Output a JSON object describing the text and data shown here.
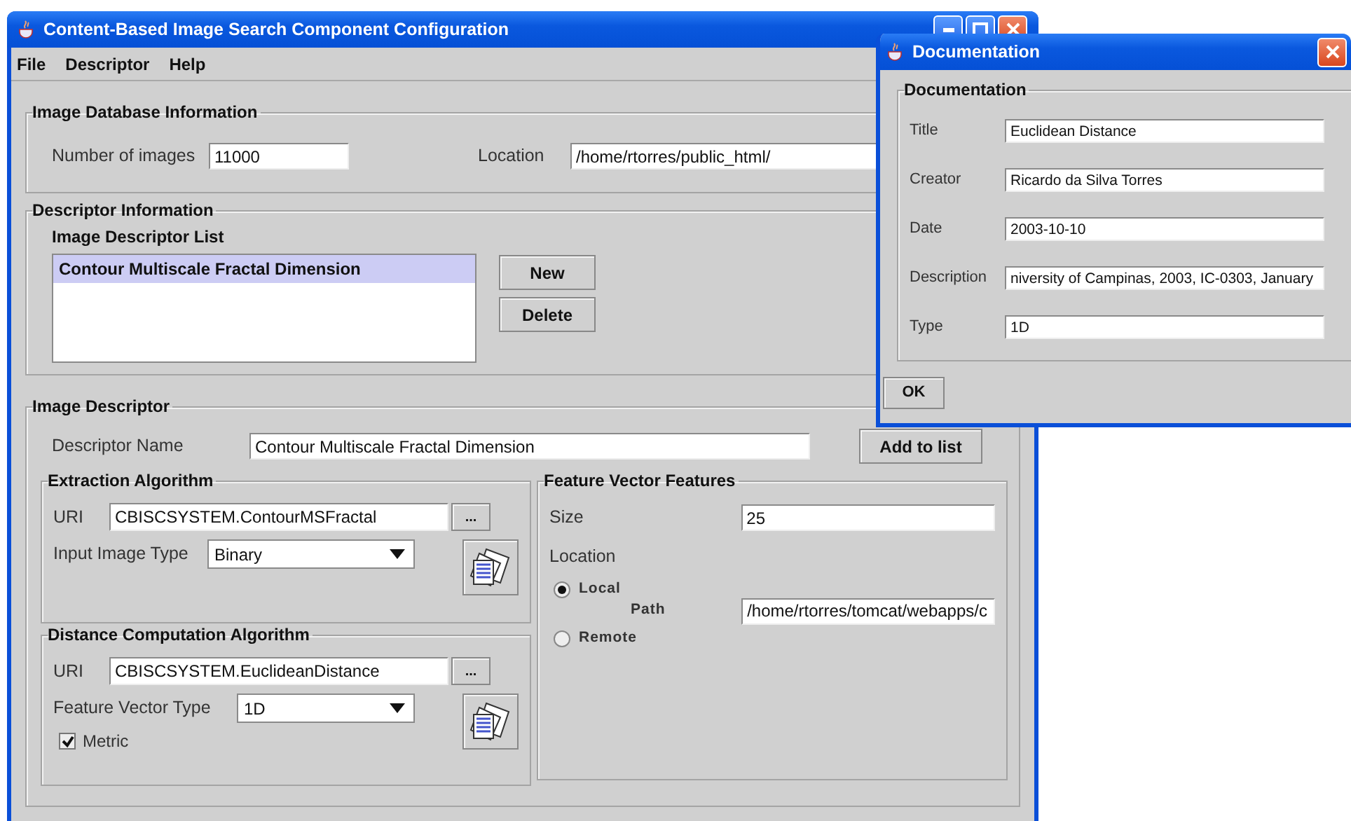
{
  "main_window": {
    "title": "Content-Based Image Search Component Configuration",
    "menu": [
      "File",
      "Descriptor",
      "Help"
    ],
    "database": {
      "title": "Image Database Information",
      "count_label": "Number of images",
      "count": "11000",
      "location_label": "Location",
      "location": "/home/rtorres/public_html/"
    },
    "descriptor_info": {
      "title": "Descriptor Information",
      "list_label": "Image Descriptor List",
      "items": [
        {
          "label": "Contour Multiscale Fractal Dimension",
          "selected": true
        }
      ],
      "buttons": [
        "New",
        "Delete"
      ]
    },
    "image_descriptor": {
      "title": "Image Descriptor",
      "name_label": "Descriptor Name",
      "name": "Contour Multiscale Fractal Dimension",
      "add_button": "Add to list",
      "extraction": {
        "title": "Extraction Algorithm",
        "uri_label": "URI",
        "uri": "CBISCSYSTEM.ContourMSFractal",
        "browse_button": "...",
        "type_label": "Input Image Type",
        "type": "Binary"
      },
      "distance": {
        "title": "Distance Computation Algorithm",
        "uri_label": "URI",
        "uri": "CBISCSYSTEM.EuclideanDistance",
        "browse_button": "...",
        "type_label": "Feature Vector Type",
        "type": "1D",
        "metric": {
          "label": "Metric",
          "checked": true
        }
      },
      "features": {
        "title": "Feature Vector Features",
        "size_label": "Size",
        "size": "25",
        "location_label": "Location",
        "options": [
          {
            "label": "Local",
            "selected": true
          },
          {
            "label": "Remote",
            "selected": false
          }
        ],
        "path_label": "Path",
        "path": "/home/rtorres/tomcat/webapps/c"
      }
    }
  },
  "dialog": {
    "title": "Documentation",
    "group_title": "Documentation",
    "fields": [
      {
        "label": "Title",
        "value": "Euclidean Distance"
      },
      {
        "label": "Creator",
        "value": "Ricardo da Silva Torres"
      },
      {
        "label": "Date",
        "value": "2003-10-10"
      },
      {
        "label": "Description",
        "value": "niversity of Campinas, 2003, IC-0303, January"
      },
      {
        "label": "Type",
        "value": "1D"
      }
    ],
    "ok_button": "OK"
  }
}
